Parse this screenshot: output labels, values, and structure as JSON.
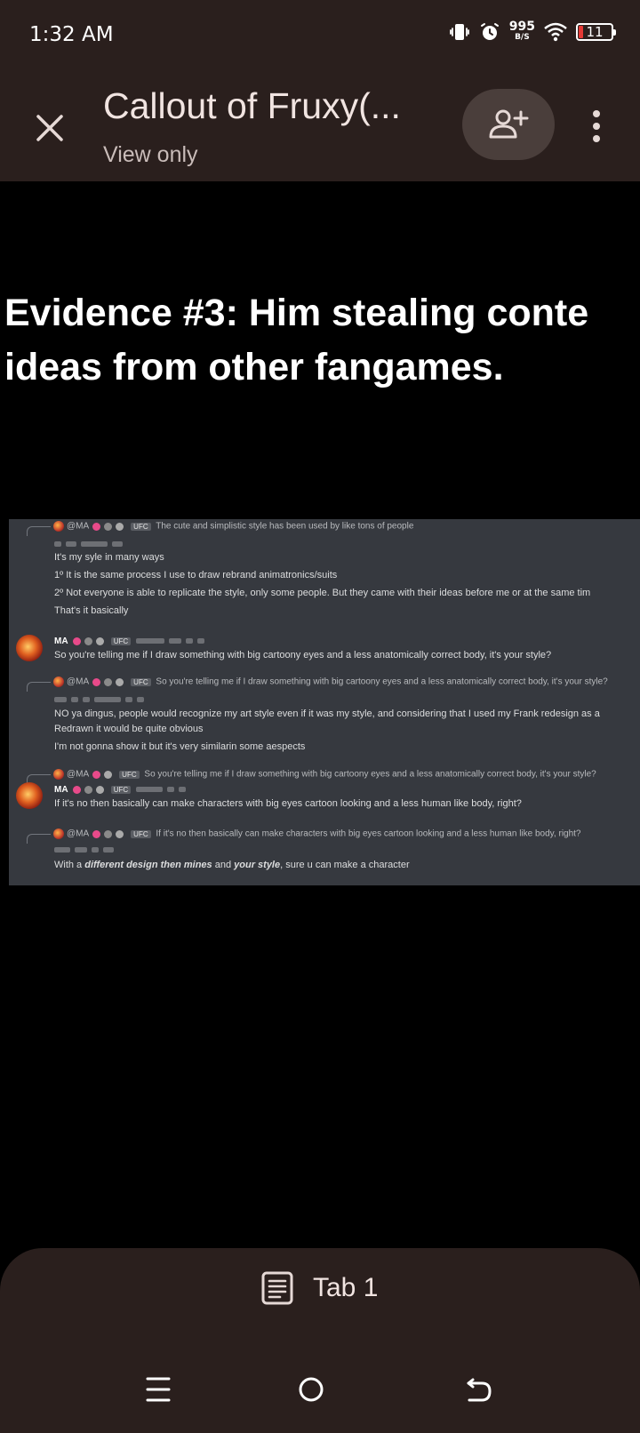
{
  "status_bar": {
    "time": "1:32 AM",
    "net_speed_value": "995",
    "net_speed_unit": "B/S",
    "battery_level": "11",
    "battery_color": "#e53935"
  },
  "app_bar": {
    "title": "Callout of Fruxy(...",
    "subtitle": "View only",
    "close_icon": "close-icon",
    "share_icon": "person-add-icon",
    "more_icon": "more-vert-icon"
  },
  "document": {
    "heading_line1": "Evidence #3: Him stealing conte",
    "heading_line2": "ideas from other fangames.",
    "screenshot": {
      "reply1_prefix": "@MA",
      "reply1_badge": "UFC",
      "reply1_text": "The cute and simplistic style has been used by like tons of people",
      "line1": "It's my syle in many ways",
      "line2": "1º It is the same process I use to draw rebrand animatronics/suits",
      "line3": "2º Not everyone is able to replicate the style, only some people. But they came with their ideas before me or at the same tim",
      "line4": "That's it basically",
      "msg2_user": "MA",
      "msg2_badge": "UFC",
      "msg2_text": "So you're telling me if I draw something with big cartoony eyes and a less anatomically correct body, it's your style?",
      "reply3_prefix": "@MA",
      "reply3_badge": "UFC",
      "reply3_text": "So you're telling me if I draw something with big cartoony eyes and a less anatomically correct body, it's your style?",
      "line5": "NO ya dingus, people would recognize my art style even if it was my style, and considering that I used my Frank redesign as a",
      "line6": "Redrawn it would be quite obvious",
      "line7": "I'm not gonna show it but it's very similarin some aespects",
      "reply4_prefix": "@MA",
      "reply4_badge": "UFC",
      "reply4_text": "So you're telling me if I draw something with big cartoony eyes and a less anatomically correct body, it's your style?",
      "msg4_user": "MA",
      "msg4_badge": "UFC",
      "msg4_text": "If it's no then basically can make characters with big eyes cartoon looking and a less human like body, right?",
      "reply5_prefix": "@MA",
      "reply5_badge": "UFC",
      "reply5_text": "If it's no then basically can make characters with big eyes cartoon looking and a less human like body, right?",
      "line8_pre": "With a ",
      "line8_em1": "different design then mines",
      "line8_mid": " and ",
      "line8_em2": "your style",
      "line8_post": ", sure u can make a character"
    }
  },
  "bottom": {
    "tab_label": "Tab 1",
    "tab_icon": "document-icon",
    "nav_recents_icon": "menu-icon",
    "nav_home_icon": "home-circle-icon",
    "nav_back_icon": "back-icon"
  }
}
